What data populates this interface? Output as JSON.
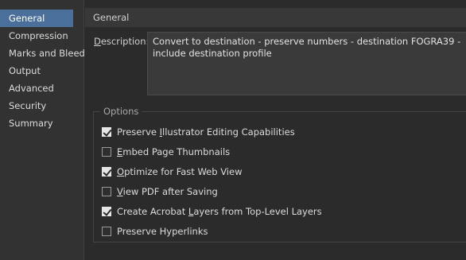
{
  "sidebar": {
    "items": [
      {
        "label": "General",
        "active": true
      },
      {
        "label": "Compression"
      },
      {
        "label": "Marks and Bleeds"
      },
      {
        "label": "Output"
      },
      {
        "label": "Advanced"
      },
      {
        "label": "Security"
      },
      {
        "label": "Summary"
      }
    ]
  },
  "main": {
    "section_title": "General",
    "description": {
      "label_underlined": "D",
      "label_rest": "escription:",
      "value": "Convert to destination - preserve numbers - destination FOGRA39 - include destination profile"
    },
    "options_group": {
      "title": "Options",
      "items": [
        {
          "pre": "Preserve ",
          "u": "I",
          "post": "llustrator Editing Capabilities",
          "checked": true
        },
        {
          "pre": "",
          "u": "E",
          "post": "mbed Page Thumbnails",
          "checked": false
        },
        {
          "pre": "",
          "u": "O",
          "post": "ptimize for Fast Web View",
          "checked": true
        },
        {
          "pre": "",
          "u": "V",
          "post": "iew PDF after Saving",
          "checked": false
        },
        {
          "pre": "Create Acrobat ",
          "u": "L",
          "post": "ayers from Top-Level Layers",
          "checked": true
        },
        {
          "pre": "Preserve Hyperlinks",
          "u": "",
          "post": "",
          "checked": false
        }
      ]
    }
  },
  "colors": {
    "background": "#2b2b2b",
    "sidebar_bg": "#323232",
    "active_item_bg": "#4a6f9a",
    "header_bg": "#383838"
  }
}
